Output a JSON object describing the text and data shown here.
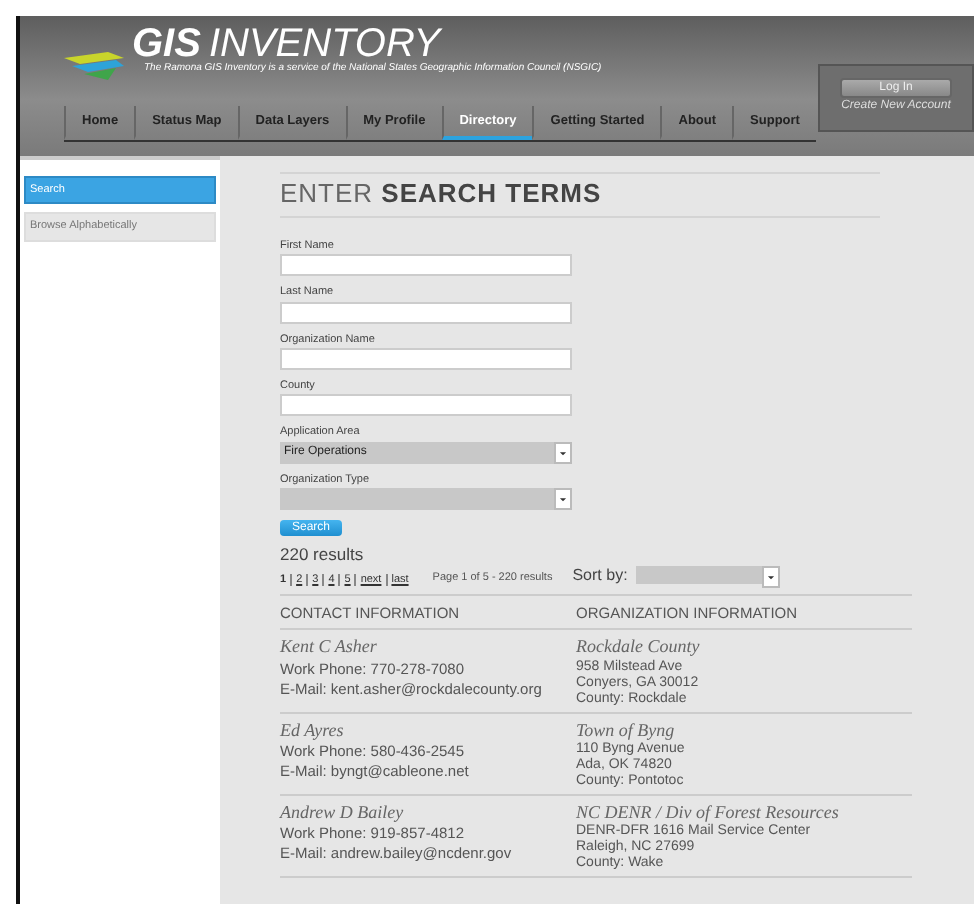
{
  "header": {
    "logo_bold": "GIS",
    "logo_light": "INVENTORY",
    "tagline": "The Ramona GIS Inventory is a service of the National States Geographic Information Council (NSGIC)",
    "nav": [
      {
        "label": "Home",
        "selected": false
      },
      {
        "label": "Status Map",
        "selected": false
      },
      {
        "label": "Data Layers",
        "selected": false
      },
      {
        "label": "My Profile",
        "selected": false
      },
      {
        "label": "Directory",
        "selected": true
      },
      {
        "label": "Getting Started",
        "selected": false
      },
      {
        "label": "About",
        "selected": false
      },
      {
        "label": "Support",
        "selected": false
      }
    ],
    "login": {
      "button": "Log In",
      "link": "Create New Account"
    }
  },
  "sidebar": {
    "items": [
      {
        "label": "Search",
        "selected": true
      },
      {
        "label": "Browse Alphabetically",
        "selected": false
      }
    ]
  },
  "form": {
    "heading": "ENTER **SEARCH TERMS**",
    "fields": [
      {
        "kind": "text",
        "label": "First Name"
      },
      {
        "kind": "text",
        "label": "Last Name"
      },
      {
        "kind": "text",
        "label": "Organization Name"
      },
      {
        "kind": "text",
        "label": "County"
      },
      {
        "kind": "select",
        "label": "Application Area",
        "value": "Fire Operations"
      },
      {
        "kind": "select",
        "label": "Organization Type"
      }
    ],
    "button": "Search"
  },
  "results": {
    "count": "220 results",
    "pages": [
      {
        "label": "1",
        "selected": true
      },
      {
        "label": "2",
        "selected": false
      },
      {
        "label": "3",
        "selected": false
      },
      {
        "label": "4",
        "selected": false
      },
      {
        "label": "5",
        "selected": false
      },
      {
        "label": "next",
        "selected": false
      },
      {
        "label": "last",
        "selected": false
      }
    ],
    "page_info": "Page 1 of 5 - 220 results",
    "sort_label": "Sort by:",
    "columns": [
      "CONTACT INFORMATION",
      "ORGANIZATION INFORMATION"
    ],
    "records": [
      {
        "name": "Kent C Asher",
        "phone": "Work Phone: 770-278-7080",
        "email": "E-Mail: kent.asher@rockdalecounty.org",
        "org": "Rockdale County",
        "address": [
          "958 Milstead Ave",
          "Conyers, GA 30012",
          "County: Rockdale"
        ]
      },
      {
        "name": "Ed Ayres",
        "phone": "Work Phone: 580-436-2545",
        "email": "E-Mail: byngt@cableone.net",
        "org": "Town of Byng",
        "address": [
          "110 Byng Avenue",
          "Ada, OK 74820",
          "County: Pontotoc"
        ]
      },
      {
        "name": "Andrew D Bailey",
        "phone": "Work Phone: 919-857-4812",
        "email": "E-Mail: andrew.bailey@ncdenr.gov",
        "org": "NC DENR / Div of Forest Resources",
        "address": [
          "DENR-DFR 1616 Mail Service Center",
          "Raleigh, NC 27699",
          "County: Wake"
        ]
      }
    ]
  }
}
